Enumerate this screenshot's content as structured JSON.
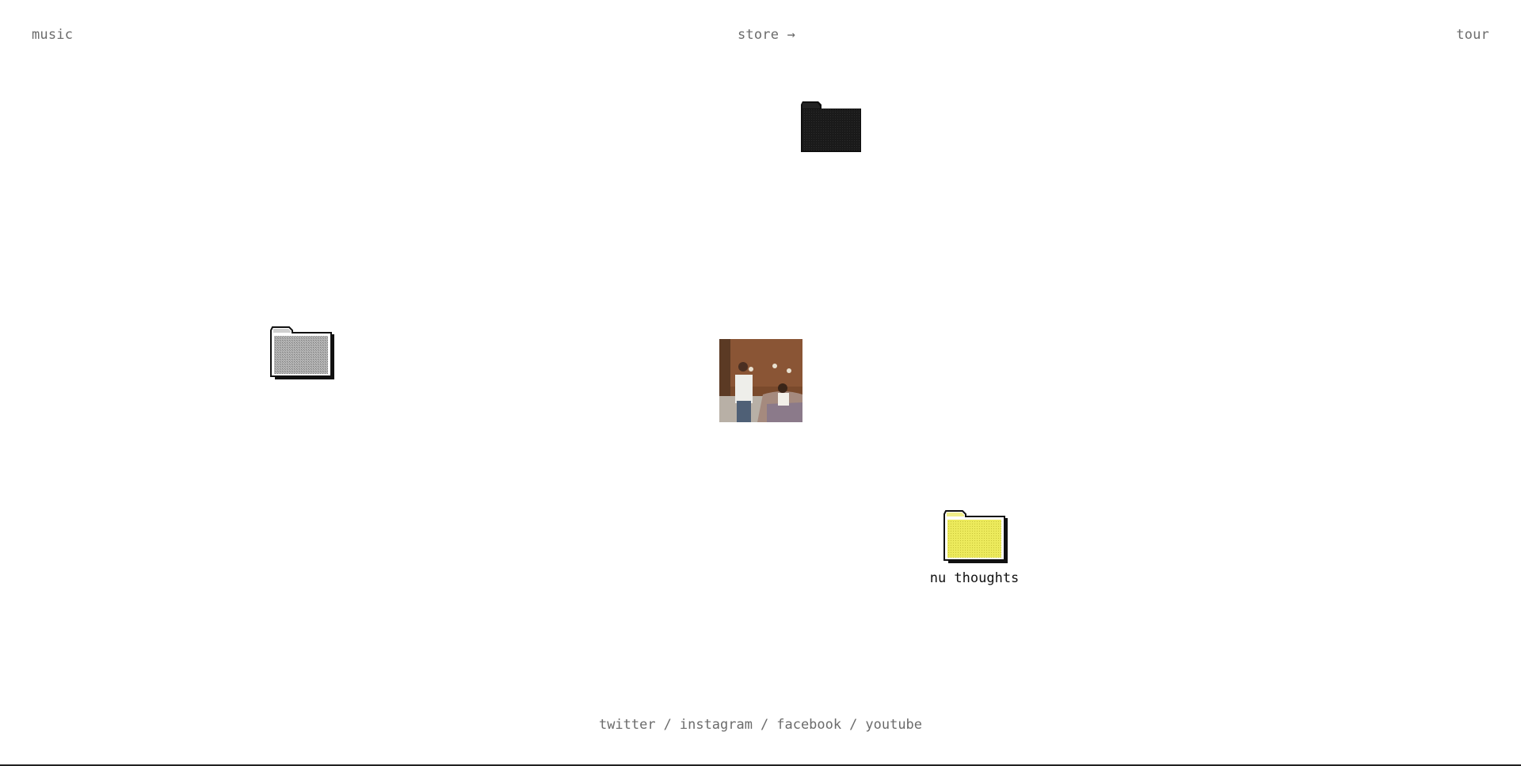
{
  "nav": {
    "left_label": "music",
    "center_label": "store →",
    "right_label": "tour"
  },
  "folders": [
    {
      "name": "black-folder",
      "color": "#1a1a1a"
    },
    {
      "name": "gray-folder",
      "color": "#a8a8a8"
    },
    {
      "name": "yellow-folder",
      "color": "#e6e05a",
      "label": "nu thoughts"
    }
  ],
  "album": {
    "icon": "album-cover-photo"
  },
  "footer": {
    "links": [
      "twitter",
      "instagram",
      "facebook",
      "youtube"
    ],
    "separator": "/"
  }
}
